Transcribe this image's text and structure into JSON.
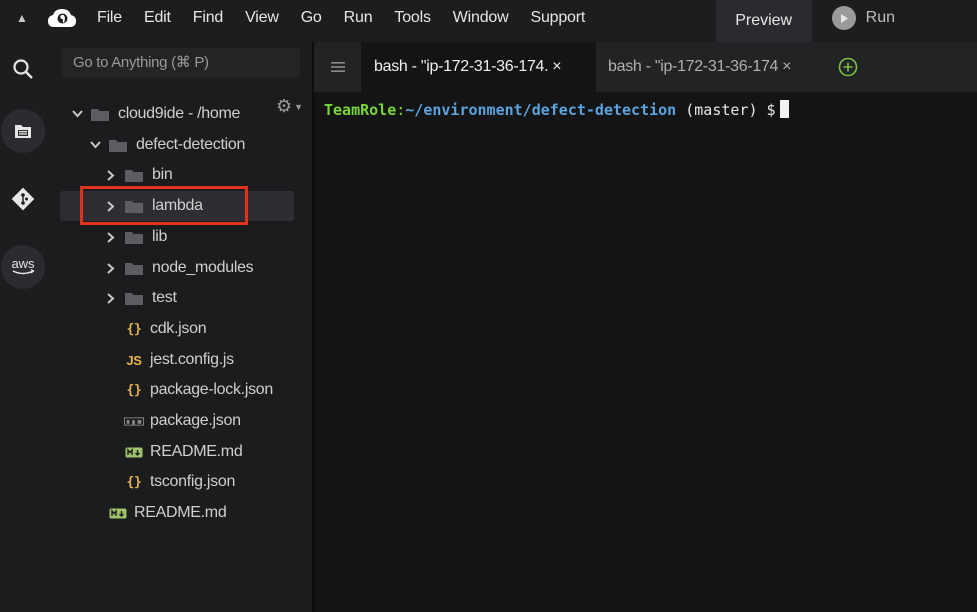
{
  "menubar": {
    "items": [
      "File",
      "Edit",
      "Find",
      "View",
      "Go",
      "Run",
      "Tools",
      "Window",
      "Support"
    ],
    "preview_label": "Preview",
    "run_label": "Run"
  },
  "sidebar": {
    "goto_placeholder": "Go to Anything (⌘ P)",
    "tree": [
      {
        "label": "cloud9ide - /home",
        "kind": "folder",
        "state": "expanded"
      },
      {
        "label": "defect-detection",
        "kind": "folder",
        "state": "expanded"
      },
      {
        "label": "bin",
        "kind": "folder",
        "state": "collapsed"
      },
      {
        "label": "lambda",
        "kind": "folder",
        "state": "collapsed"
      },
      {
        "label": "lib",
        "kind": "folder",
        "state": "collapsed"
      },
      {
        "label": "node_modules",
        "kind": "folder",
        "state": "collapsed"
      },
      {
        "label": "test",
        "kind": "folder",
        "state": "collapsed"
      },
      {
        "label": "cdk.json",
        "kind": "json"
      },
      {
        "label": "jest.config.js",
        "kind": "js"
      },
      {
        "label": "package-lock.json",
        "kind": "json"
      },
      {
        "label": "package.json",
        "kind": "npm"
      },
      {
        "label": "README.md",
        "kind": "md"
      },
      {
        "label": "tsconfig.json",
        "kind": "json"
      },
      {
        "label": "README.md",
        "kind": "md"
      }
    ],
    "selected_index": 3
  },
  "tabs": [
    {
      "label": "bash - \"ip-172-31-36-174.",
      "active": true
    },
    {
      "label": "bash - \"ip-172-31-36-174",
      "active": false
    }
  ],
  "tab_close_glyph": "×",
  "terminal": {
    "role": "TeamRole",
    "colon": ":",
    "path": "~/environment/defect-detection",
    "rest": " (master) $"
  },
  "colors": {
    "highlight": "#e0321c",
    "prompt_green": "#79d63a",
    "prompt_blue": "#5aa3e0",
    "icon_yellow": "#e8b44a",
    "icon_green": "#9fc36a"
  }
}
